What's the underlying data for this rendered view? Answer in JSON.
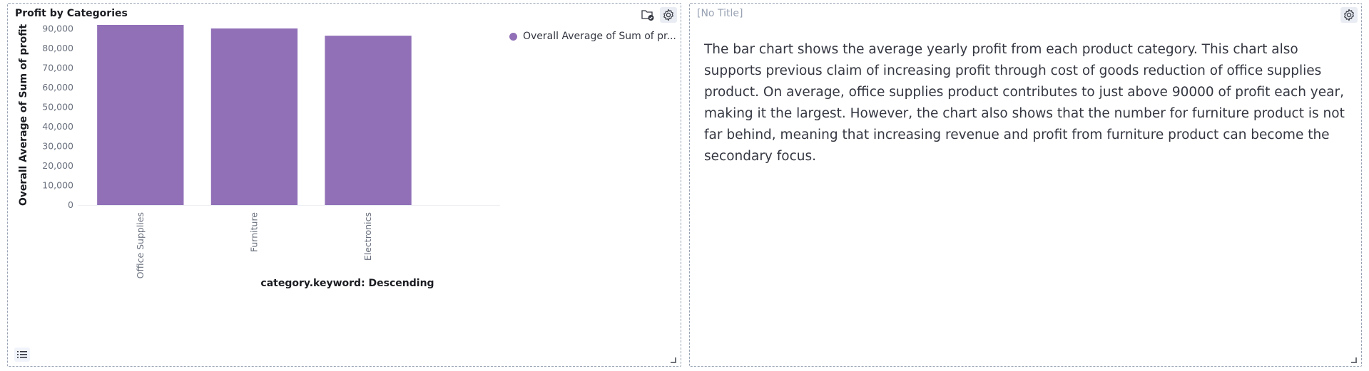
{
  "left_panel": {
    "title": "Profit by Categories",
    "legend_label": "Overall Average of Sum of pr...",
    "x_axis_title": "category.keyword: Descending",
    "y_axis_title": "Overall Average of Sum of profit"
  },
  "right_panel": {
    "title": "[No Title]",
    "text": "The bar chart shows the average yearly profit from each product category. This chart also supports previous claim of increasing profit through cost of goods reduction of office supplies product. On average, office supplies product contributes to just above 90000 of profit each year, making it the largest. However, the chart also shows that the number for furniture product is not far behind, meaning that increasing revenue and profit from furniture product can become the secondary focus."
  },
  "colors": {
    "bar": "#9170b8",
    "dashed_border": "#98a2b3"
  },
  "chart_data": {
    "type": "bar",
    "title": "Profit by Categories",
    "xlabel": "category.keyword: Descending",
    "ylabel": "Overall Average of Sum of profit",
    "categories": [
      "Office Supplies",
      "Furniture",
      "Electronics"
    ],
    "series": [
      {
        "name": "Overall Average of Sum of pr...",
        "values": [
          92000,
          90200,
          86500
        ]
      }
    ],
    "ylim": [
      0,
      92000
    ],
    "yticks": [
      0,
      10000,
      20000,
      30000,
      40000,
      50000,
      60000,
      70000,
      80000,
      90000
    ],
    "ytick_labels": [
      "0",
      "10,000",
      "20,000",
      "30,000",
      "40,000",
      "50,000",
      "60,000",
      "70,000",
      "80,000",
      "90,000"
    ],
    "grid": false,
    "legend": "top-right"
  }
}
